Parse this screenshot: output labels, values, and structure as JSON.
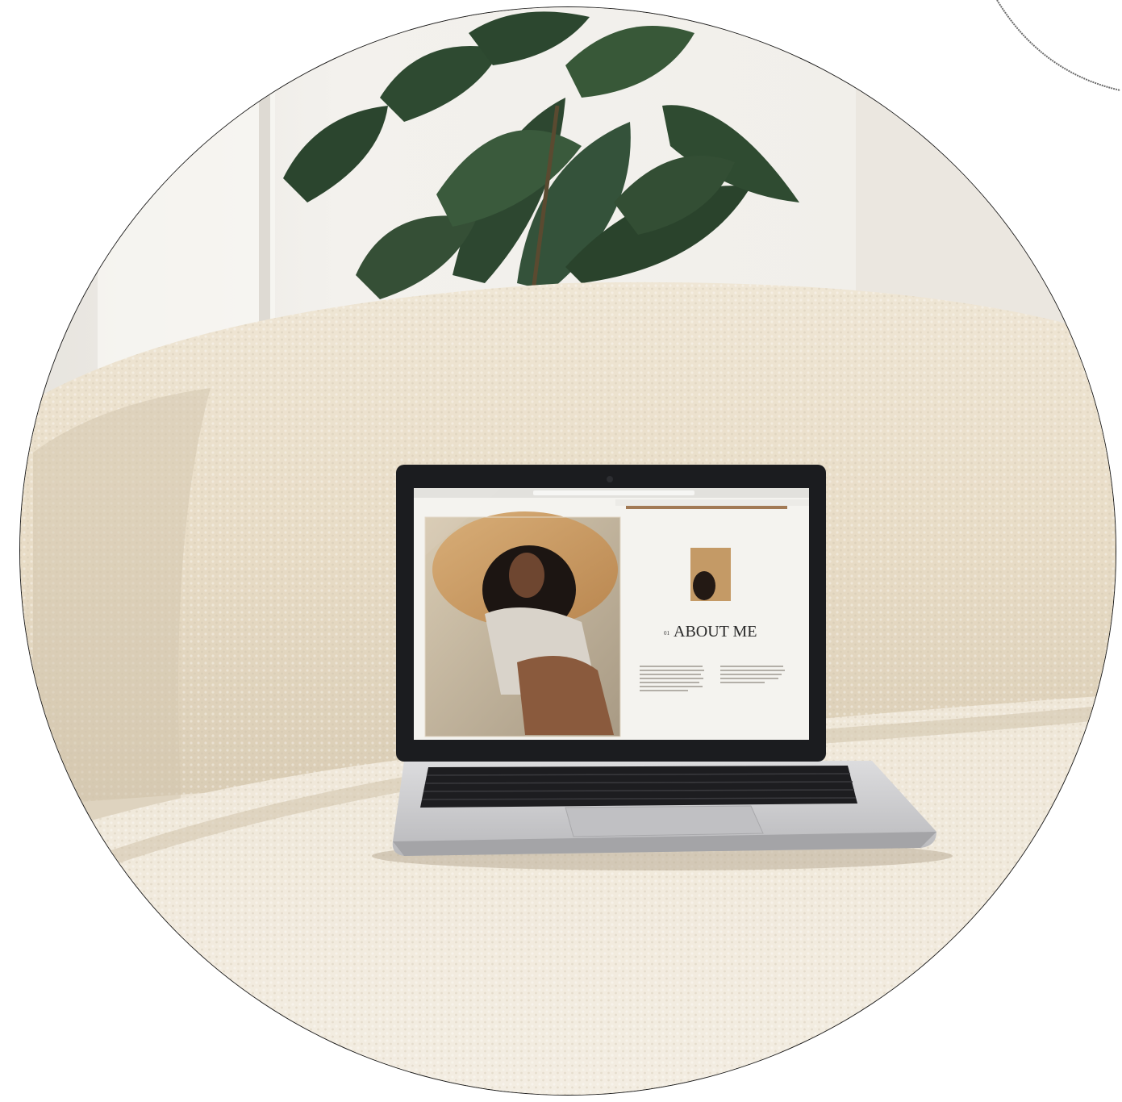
{
  "screen": {
    "heading_number": "01",
    "heading": "ABOUT ME"
  },
  "colors": {
    "wall": "#efece6",
    "sofa": "#e9e0cf",
    "sofa_shadow": "#d2c6b1",
    "leaf": "#2f4a30",
    "laptop_bezel": "#1b1c1f",
    "laptop_body": "#c9c9cb",
    "screen_bg": "#f4f3ef",
    "hat": "#c99a62"
  }
}
